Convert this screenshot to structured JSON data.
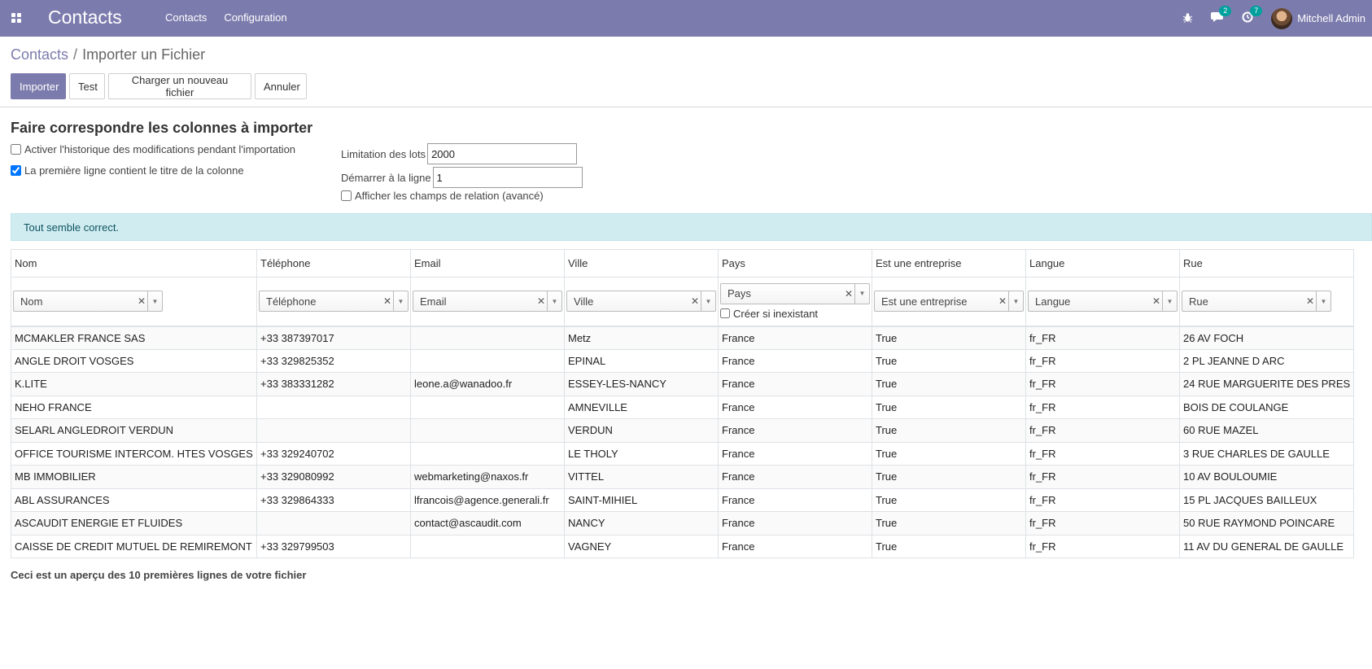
{
  "navbar": {
    "brand": "Contacts",
    "menu": [
      "Contacts",
      "Configuration"
    ],
    "messages_count": "2",
    "activities_count": "7",
    "user": "Mitchell Admin",
    "accent": "#7c7bad"
  },
  "breadcrumb": {
    "parent": "Contacts",
    "separator": "/",
    "current": "Importer un Fichier"
  },
  "buttons": {
    "import": "Importer",
    "test": "Test",
    "load_new": "Charger un nouveau fichier",
    "cancel": "Annuler"
  },
  "options": {
    "title": "Faire correspondre les colonnes à importer",
    "track_history": {
      "label": "Activer l'historique des modifications pendant l'importation",
      "checked": false
    },
    "has_headers": {
      "label": "La première ligne contient le titre de la colonne",
      "checked": true
    },
    "batch_limit": {
      "label": "Limitation des lots",
      "value": "2000"
    },
    "start_line": {
      "label": "Démarrer à la ligne",
      "value": "1"
    },
    "advanced": {
      "label": "Afficher les champs de relation (avancé)",
      "checked": false
    }
  },
  "alert": {
    "text": "Tout semble correct.",
    "color": "#d1ecf1"
  },
  "table": {
    "headers": [
      "Nom",
      "Téléphone",
      "Email",
      "Ville",
      "Pays",
      "Est une entreprise",
      "Langue",
      "Rue"
    ],
    "field_selects": [
      "Nom",
      "Téléphone",
      "Email",
      "Ville",
      "Pays",
      "Est une entreprise",
      "Langue",
      "Rue"
    ],
    "create_if_missing_label": "Créer si inexistant",
    "rows": [
      [
        "MCMAKLER FRANCE SAS",
        "+33 387397017",
        "",
        "Metz",
        "France",
        "True",
        "fr_FR",
        "26 AV FOCH"
      ],
      [
        "ANGLE DROIT VOSGES",
        "+33 329825352",
        "",
        "EPINAL",
        "France",
        "True",
        "fr_FR",
        "2 PL JEANNE D ARC"
      ],
      [
        "K.LITE",
        "+33 383331282",
        "leone.a@wanadoo.fr",
        "ESSEY-LES-NANCY",
        "France",
        "True",
        "fr_FR",
        "24 RUE MARGUERITE DES PRES"
      ],
      [
        "NEHO FRANCE",
        "",
        "",
        "AMNEVILLE",
        "France",
        "True",
        "fr_FR",
        "BOIS DE COULANGE"
      ],
      [
        "SELARL ANGLEDROIT VERDUN",
        "",
        "",
        "VERDUN",
        "France",
        "True",
        "fr_FR",
        "60 RUE MAZEL"
      ],
      [
        "OFFICE TOURISME INTERCOM. HTES VOSGES",
        "+33 329240702",
        "",
        "LE THOLY",
        "France",
        "True",
        "fr_FR",
        "3 RUE CHARLES DE GAULLE"
      ],
      [
        "MB IMMOBILIER",
        "+33 329080992",
        "webmarketing@naxos.fr",
        "VITTEL",
        "France",
        "True",
        "fr_FR",
        "10 AV BOULOUMIE"
      ],
      [
        "ABL ASSURANCES",
        "+33 329864333",
        "lfrancois@agence.generali.fr",
        "SAINT-MIHIEL",
        "France",
        "True",
        "fr_FR",
        "15 PL JACQUES BAILLEUX"
      ],
      [
        "ASCAUDIT ENERGIE ET FLUIDES",
        "",
        "contact@ascaudit.com",
        "NANCY",
        "France",
        "True",
        "fr_FR",
        "50 RUE RAYMOND POINCARE"
      ],
      [
        "CAISSE DE CREDIT MUTUEL DE REMIREMONT",
        "+33 329799503",
        "",
        "VAGNEY",
        "France",
        "True",
        "fr_FR",
        "11 AV DU GENERAL DE GAULLE"
      ]
    ]
  },
  "footnote": "Ceci est un aperçu des 10 premières lignes de votre fichier"
}
